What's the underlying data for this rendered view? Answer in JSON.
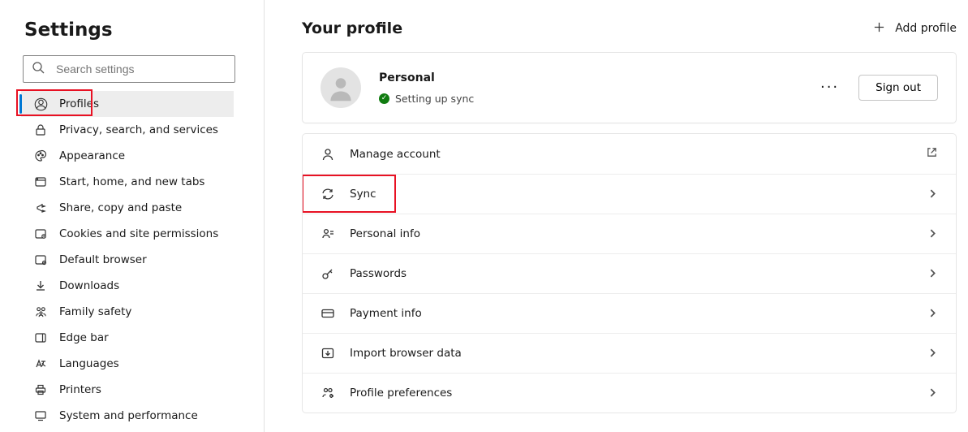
{
  "sidebar": {
    "title": "Settings",
    "search_placeholder": "Search settings",
    "items": [
      {
        "label": "Profiles"
      },
      {
        "label": "Privacy, search, and services"
      },
      {
        "label": "Appearance"
      },
      {
        "label": "Start, home, and new tabs"
      },
      {
        "label": "Share, copy and paste"
      },
      {
        "label": "Cookies and site permissions"
      },
      {
        "label": "Default browser"
      },
      {
        "label": "Downloads"
      },
      {
        "label": "Family safety"
      },
      {
        "label": "Edge bar"
      },
      {
        "label": "Languages"
      },
      {
        "label": "Printers"
      },
      {
        "label": "System and performance"
      }
    ]
  },
  "main": {
    "title": "Your profile",
    "add_profile": "Add profile",
    "profile": {
      "name": "Personal",
      "status": "Setting up sync",
      "status_color": "#107c10"
    },
    "signout": "Sign out",
    "rows": [
      {
        "label": "Manage account",
        "trail": "external"
      },
      {
        "label": "Sync",
        "trail": "chevron"
      },
      {
        "label": "Personal info",
        "trail": "chevron"
      },
      {
        "label": "Passwords",
        "trail": "chevron"
      },
      {
        "label": "Payment info",
        "trail": "chevron"
      },
      {
        "label": "Import browser data",
        "trail": "chevron"
      },
      {
        "label": "Profile preferences",
        "trail": "chevron"
      }
    ]
  }
}
